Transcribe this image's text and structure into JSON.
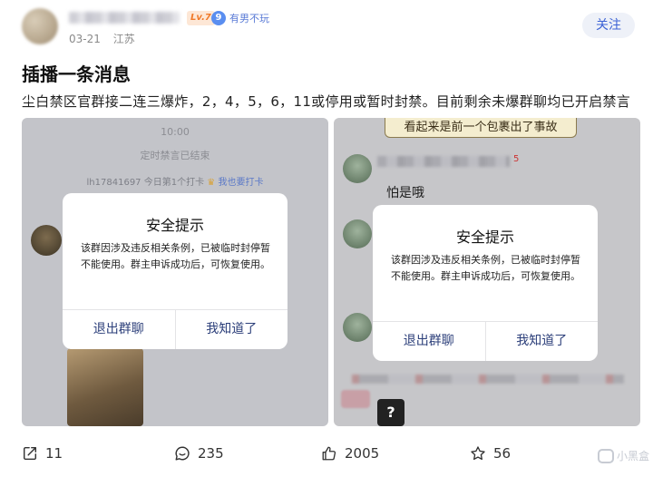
{
  "author": {
    "level": "Lv.7",
    "medal_icon": "9",
    "medal_label": "有男不玩",
    "date": "03-21",
    "location": "江苏",
    "follow_label": "关注"
  },
  "post": {
    "title": "插播一条消息",
    "body": "尘白禁区官群接二连三爆炸，2，4，5，6，11或停用或暂时封禁。目前剩余未爆群聊均已开启禁言"
  },
  "left_screenshot": {
    "time": "10:00",
    "system_notice": "定时禁言已结束",
    "checkin_user": "lh17841697",
    "checkin_text": "今日第1个打卡",
    "checkin_action": "我也要打卡"
  },
  "right_screenshot": {
    "banner": "看起来是前一个包裹出了事故",
    "name_tail": "5",
    "message": "怕是哦",
    "sticker_symbol": "?"
  },
  "dialog": {
    "title": "安全提示",
    "message": "该群因涉及违反相关条例，已被临时封停暂不能使用。群主申诉成功后，可恢复使用。",
    "exit_label": "退出群聊",
    "ok_label": "我知道了"
  },
  "actions": {
    "share_count": "11",
    "comment_count": "235",
    "like_count": "2005",
    "favorite_count": "56"
  },
  "watermark": "小黑盒",
  "colors": {
    "accent_blue": "#3d63d6",
    "level_orange": "#f07a2a",
    "dialog_button": "#2c3f7a"
  }
}
